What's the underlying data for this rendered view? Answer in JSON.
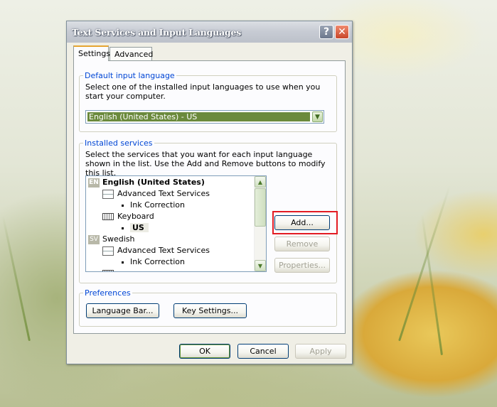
{
  "window": {
    "title": "Text Services and Input Languages",
    "help_label": "?",
    "close_label": "✕"
  },
  "tabs": [
    {
      "label": "Settings",
      "active": true
    },
    {
      "label": "Advanced",
      "active": false
    }
  ],
  "default_language": {
    "group_label": "Default input language",
    "description": "Select one of the installed input languages to use when you start your computer.",
    "selected": "English (United States) - US"
  },
  "installed_services": {
    "group_label": "Installed services",
    "description": "Select the services that you want for each input language shown in the list. Use the Add and Remove buttons to modify this list.",
    "tree": [
      {
        "badge": "EN",
        "label": "English (United States)"
      },
      {
        "label": "Advanced Text Services"
      },
      {
        "label": "Ink Correction"
      },
      {
        "label": "Keyboard"
      },
      {
        "label": "US"
      },
      {
        "badge": "SV",
        "label": "Swedish"
      },
      {
        "label": "Advanced Text Services"
      },
      {
        "label": "Ink Correction"
      }
    ],
    "add_label": "Add...",
    "remove_label": "Remove",
    "properties_label": "Properties..."
  },
  "preferences": {
    "group_label": "Preferences",
    "language_bar_label": "Language Bar...",
    "key_settings_label": "Key Settings..."
  },
  "dialog": {
    "ok_label": "OK",
    "cancel_label": "Cancel",
    "apply_label": "Apply"
  },
  "colors": {
    "highlight": "#e31b23",
    "group_label": "#0046d5",
    "selected_combo": "#6b8a3c"
  }
}
